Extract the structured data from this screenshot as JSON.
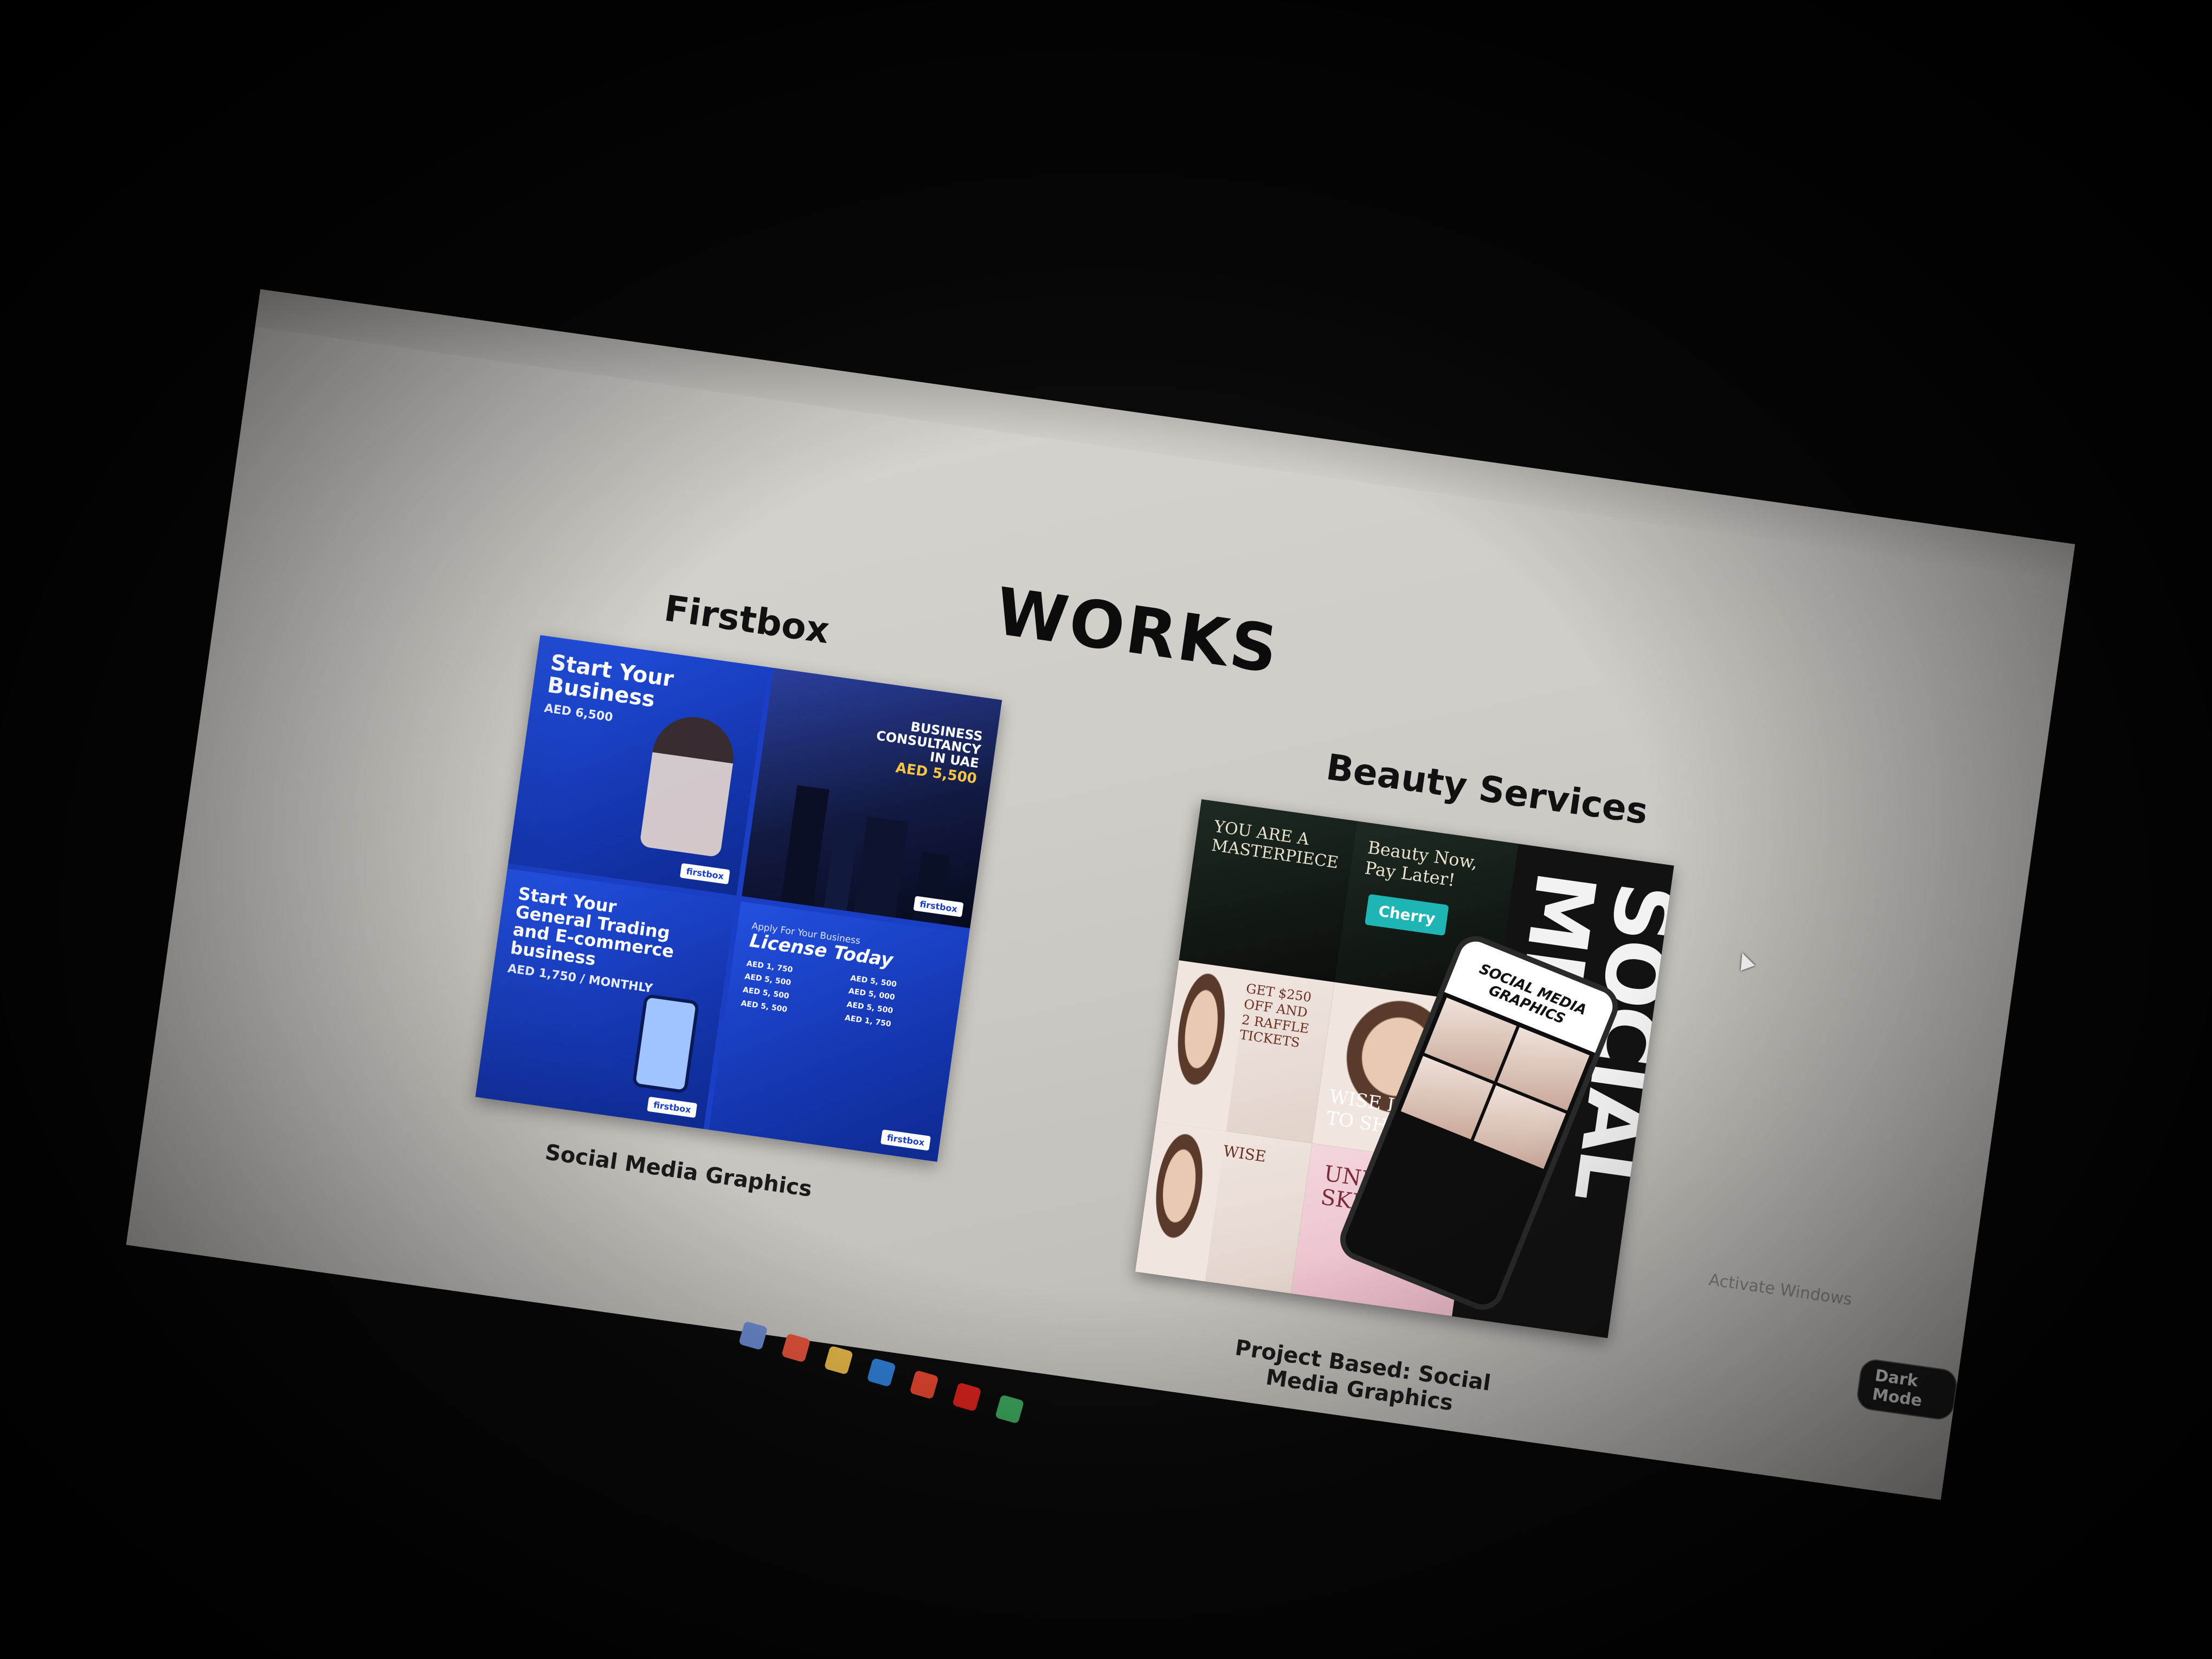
{
  "page": {
    "heading": "WORKS",
    "projects": [
      {
        "title": "Firstbox",
        "caption": "Social Media Graphics",
        "tiles": [
          {
            "headline": "Start Your Business",
            "price": "AED 6,500",
            "logo": "firstbox"
          },
          {
            "lines": [
              "BUSINESS",
              "CONSULTANCY",
              "IN UAE"
            ],
            "price": "AED 5,500",
            "logo": "firstbox"
          },
          {
            "headline": "Start Your General Trading and E-commerce business",
            "price": "AED 1,750 / MONTHLY",
            "logo": "firstbox"
          },
          {
            "kicker": "Apply For Your Business",
            "headline": "License Today",
            "items": [
              {
                "price": "AED 1, 750"
              },
              {
                "price": "AED 5, 500"
              },
              {
                "price": "AED 5, 500"
              },
              {
                "price": "AED 5, 000"
              },
              {
                "price": "AED 5, 500"
              },
              {
                "price": "AED 5, 500"
              },
              {
                "price": "AED 5, 500"
              },
              {
                "price": "AED 1, 750"
              }
            ],
            "logo": "firstbox"
          }
        ]
      },
      {
        "title": "Beauty Services",
        "caption_line1": "Project Based: Social",
        "caption_line2": "Media Graphics",
        "collage": {
          "masterpiece": "YOU ARE A MASTERPIECE",
          "beauty_now": "Beauty Now, Pay Later!",
          "cherry": "Cherry",
          "offer": "GET $250 OFF AND 2 RAFFLE TICKETS",
          "wise": "WISE LIPS TO SHARE",
          "wise2": "WISE",
          "under": "UNDER SKIN",
          "big_word": "SOCIAL MEDIA",
          "phone_label": "SOCIAL MEDIA GRAPHICS"
        }
      }
    ],
    "dark_mode_label": "Dark Mode",
    "activate_text": "Activate Windows"
  },
  "colors": {
    "page_bg": "#d9d6d1",
    "firstbox_blue": "#1b3fc4",
    "accent_gold": "#f5c542",
    "cherry_teal": "#1fb5b5"
  },
  "taskbar_icons": [
    "shield-icon",
    "xampp-icon",
    "folder-icon",
    "vscode-icon",
    "brave-icon",
    "youtube-icon",
    "maps-icon"
  ]
}
